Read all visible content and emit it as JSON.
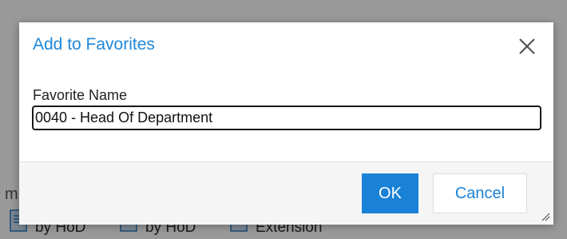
{
  "background": {
    "partial_letter": "m",
    "items": [
      {
        "label": "by HoD",
        "icon": "document-icon"
      },
      {
        "label": "by HoD",
        "icon": "document-icon"
      },
      {
        "label": "Extension",
        "icon": "document-icon"
      }
    ]
  },
  "dialog": {
    "title": "Add to Favorites",
    "close_icon": "close-icon",
    "field_label": "Favorite Name",
    "field_value": "0040 - Head Of Department",
    "ok_label": "OK",
    "cancel_label": "Cancel",
    "resize_icon": "resize-grip-icon"
  },
  "colors": {
    "accent": "#1a82d6",
    "title": "#1f87d8",
    "footer_bg": "#f5f5f5"
  }
}
